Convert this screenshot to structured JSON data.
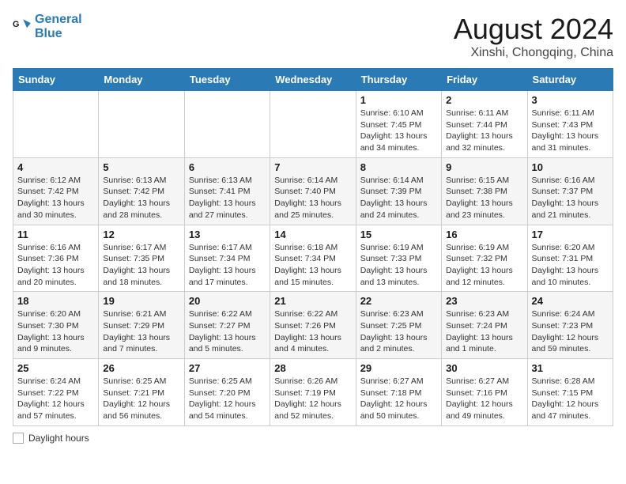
{
  "logo": {
    "line1": "General",
    "line2": "Blue"
  },
  "title": "August 2024",
  "subtitle": "Xinshi, Chongqing, China",
  "days_of_week": [
    "Sunday",
    "Monday",
    "Tuesday",
    "Wednesday",
    "Thursday",
    "Friday",
    "Saturday"
  ],
  "legend": {
    "box_label": "Daylight hours"
  },
  "weeks": [
    [
      {
        "day": "",
        "info": ""
      },
      {
        "day": "",
        "info": ""
      },
      {
        "day": "",
        "info": ""
      },
      {
        "day": "",
        "info": ""
      },
      {
        "day": "1",
        "info": "Sunrise: 6:10 AM\nSunset: 7:45 PM\nDaylight: 13 hours\nand 34 minutes."
      },
      {
        "day": "2",
        "info": "Sunrise: 6:11 AM\nSunset: 7:44 PM\nDaylight: 13 hours\nand 32 minutes."
      },
      {
        "day": "3",
        "info": "Sunrise: 6:11 AM\nSunset: 7:43 PM\nDaylight: 13 hours\nand 31 minutes."
      }
    ],
    [
      {
        "day": "4",
        "info": "Sunrise: 6:12 AM\nSunset: 7:42 PM\nDaylight: 13 hours\nand 30 minutes."
      },
      {
        "day": "5",
        "info": "Sunrise: 6:13 AM\nSunset: 7:42 PM\nDaylight: 13 hours\nand 28 minutes."
      },
      {
        "day": "6",
        "info": "Sunrise: 6:13 AM\nSunset: 7:41 PM\nDaylight: 13 hours\nand 27 minutes."
      },
      {
        "day": "7",
        "info": "Sunrise: 6:14 AM\nSunset: 7:40 PM\nDaylight: 13 hours\nand 25 minutes."
      },
      {
        "day": "8",
        "info": "Sunrise: 6:14 AM\nSunset: 7:39 PM\nDaylight: 13 hours\nand 24 minutes."
      },
      {
        "day": "9",
        "info": "Sunrise: 6:15 AM\nSunset: 7:38 PM\nDaylight: 13 hours\nand 23 minutes."
      },
      {
        "day": "10",
        "info": "Sunrise: 6:16 AM\nSunset: 7:37 PM\nDaylight: 13 hours\nand 21 minutes."
      }
    ],
    [
      {
        "day": "11",
        "info": "Sunrise: 6:16 AM\nSunset: 7:36 PM\nDaylight: 13 hours\nand 20 minutes."
      },
      {
        "day": "12",
        "info": "Sunrise: 6:17 AM\nSunset: 7:35 PM\nDaylight: 13 hours\nand 18 minutes."
      },
      {
        "day": "13",
        "info": "Sunrise: 6:17 AM\nSunset: 7:34 PM\nDaylight: 13 hours\nand 17 minutes."
      },
      {
        "day": "14",
        "info": "Sunrise: 6:18 AM\nSunset: 7:34 PM\nDaylight: 13 hours\nand 15 minutes."
      },
      {
        "day": "15",
        "info": "Sunrise: 6:19 AM\nSunset: 7:33 PM\nDaylight: 13 hours\nand 13 minutes."
      },
      {
        "day": "16",
        "info": "Sunrise: 6:19 AM\nSunset: 7:32 PM\nDaylight: 13 hours\nand 12 minutes."
      },
      {
        "day": "17",
        "info": "Sunrise: 6:20 AM\nSunset: 7:31 PM\nDaylight: 13 hours\nand 10 minutes."
      }
    ],
    [
      {
        "day": "18",
        "info": "Sunrise: 6:20 AM\nSunset: 7:30 PM\nDaylight: 13 hours\nand 9 minutes."
      },
      {
        "day": "19",
        "info": "Sunrise: 6:21 AM\nSunset: 7:29 PM\nDaylight: 13 hours\nand 7 minutes."
      },
      {
        "day": "20",
        "info": "Sunrise: 6:22 AM\nSunset: 7:27 PM\nDaylight: 13 hours\nand 5 minutes."
      },
      {
        "day": "21",
        "info": "Sunrise: 6:22 AM\nSunset: 7:26 PM\nDaylight: 13 hours\nand 4 minutes."
      },
      {
        "day": "22",
        "info": "Sunrise: 6:23 AM\nSunset: 7:25 PM\nDaylight: 13 hours\nand 2 minutes."
      },
      {
        "day": "23",
        "info": "Sunrise: 6:23 AM\nSunset: 7:24 PM\nDaylight: 13 hours\nand 1 minute."
      },
      {
        "day": "24",
        "info": "Sunrise: 6:24 AM\nSunset: 7:23 PM\nDaylight: 12 hours\nand 59 minutes."
      }
    ],
    [
      {
        "day": "25",
        "info": "Sunrise: 6:24 AM\nSunset: 7:22 PM\nDaylight: 12 hours\nand 57 minutes."
      },
      {
        "day": "26",
        "info": "Sunrise: 6:25 AM\nSunset: 7:21 PM\nDaylight: 12 hours\nand 56 minutes."
      },
      {
        "day": "27",
        "info": "Sunrise: 6:25 AM\nSunset: 7:20 PM\nDaylight: 12 hours\nand 54 minutes."
      },
      {
        "day": "28",
        "info": "Sunrise: 6:26 AM\nSunset: 7:19 PM\nDaylight: 12 hours\nand 52 minutes."
      },
      {
        "day": "29",
        "info": "Sunrise: 6:27 AM\nSunset: 7:18 PM\nDaylight: 12 hours\nand 50 minutes."
      },
      {
        "day": "30",
        "info": "Sunrise: 6:27 AM\nSunset: 7:16 PM\nDaylight: 12 hours\nand 49 minutes."
      },
      {
        "day": "31",
        "info": "Sunrise: 6:28 AM\nSunset: 7:15 PM\nDaylight: 12 hours\nand 47 minutes."
      }
    ]
  ]
}
